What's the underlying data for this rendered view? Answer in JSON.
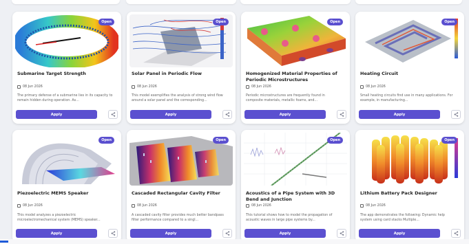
{
  "cards": [
    {
      "title": "Submarine Target Strength",
      "badge": "Open",
      "date": "08 Jun 2026",
      "desc": "The primary defense of a submarine lies in its capacity to remain hidden during operation. As...",
      "apply": "Apply",
      "thumb_icon": "submarine-scattering-thumbnail"
    },
    {
      "title": "Solar Panel in Periodic Flow",
      "badge": "Open",
      "date": "08 Jun 2026",
      "desc": "This model exemplifies the analysis of strong wind flow around a solar panel and the corresponding...",
      "apply": "Apply",
      "thumb_icon": "solar-panel-flow-thumbnail"
    },
    {
      "title": "Homogenized Material Properties of Periodic Microstructures",
      "badge": "Open",
      "date": "08 Jun 2026",
      "desc": "Periodic microstructures are frequently found in composite materials, metallic foams, and...",
      "apply": "Apply",
      "thumb_icon": "microstructure-thumbnail"
    },
    {
      "title": "Heating Circuit",
      "badge": "Open",
      "date": "08 Jun 2026",
      "desc": "Small heating circuits find use in many applications. For example, in manufacturing...",
      "apply": "Apply",
      "thumb_icon": "heating-circuit-thumbnail"
    },
    {
      "title": "Piezoelectric MEMS Speaker",
      "badge": "Open",
      "date": "08 Jun 2026",
      "desc": "This model analyzes a piezoelectric microelectromechanical system (MEMS) speaker...",
      "apply": "Apply",
      "thumb_icon": "mems-speaker-thumbnail"
    },
    {
      "title": "Cascaded Rectangular Cavity Filter",
      "badge": "Open",
      "date": "08 Jun 2026",
      "desc": "A cascaded cavity filter provides much better bandpass filter performance compared to a singl...",
      "apply": "Apply",
      "thumb_icon": "cavity-filter-thumbnail"
    },
    {
      "title": "Acoustics of a Pipe System with 3D Bend and Junction",
      "badge": "Open",
      "date": "08 Jun 2026",
      "desc": "This tutorial shows how to model the propagation of acoustic waves in large pipe systems by...",
      "apply": "Apply",
      "thumb_icon": "pipe-acoustics-thumbnail"
    },
    {
      "title": "Lithium Battery Pack Designer",
      "badge": "Open",
      "date": "08 Jun 2026",
      "desc": "The app demonstrates the following: Dynamic help system using card stacks Multiple...",
      "apply": "Apply",
      "thumb_icon": "battery-pack-thumbnail"
    }
  ],
  "colors": {
    "accent": "#5b50d0",
    "badge": "#5a4fcf",
    "background": "#eef0f4"
  }
}
